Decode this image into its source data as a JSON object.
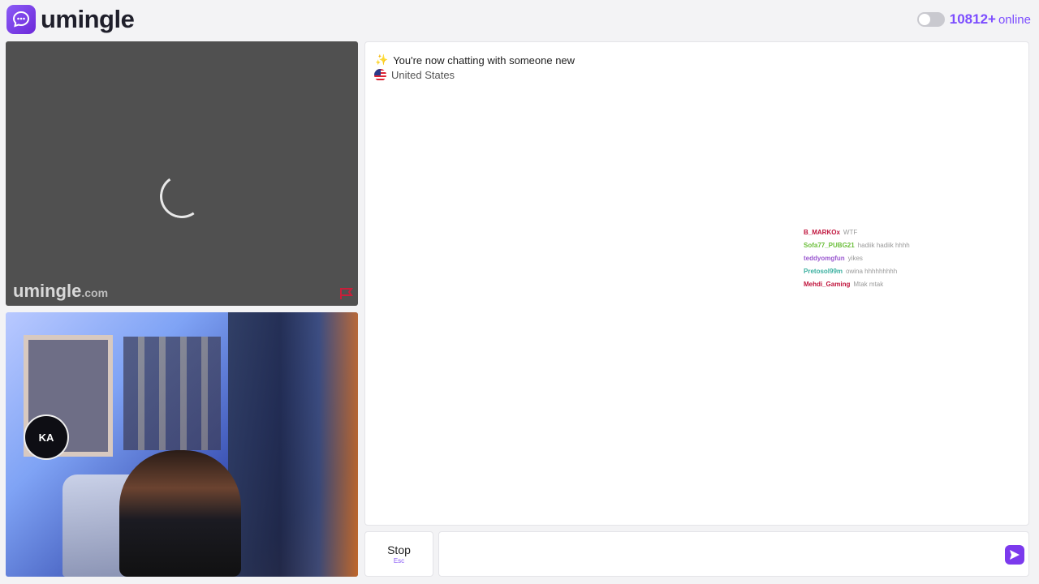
{
  "header": {
    "brand": "umingle",
    "online_count": "10812+",
    "online_label": "online"
  },
  "remote_video": {
    "watermark_brand": "umingle",
    "watermark_tld": ".com"
  },
  "local_video": {
    "badge_text": "KA"
  },
  "chat": {
    "notice": "You're now chatting with someone new",
    "country": "United States",
    "overlay_messages": [
      {
        "user": "B_MARKOx",
        "msg": "WTF",
        "color": "#c0143c"
      },
      {
        "user": "Sofa77_PUBG21",
        "msg": "hadiik hadiik hhhh",
        "color": "#6bbf3a"
      },
      {
        "user": "teddyomgfun",
        "msg": "yikes",
        "color": "#9b59d0"
      },
      {
        "user": "Pretosol99m",
        "msg": "owina hhhhhhhhh",
        "color": "#3bb0a0"
      },
      {
        "user": "Mehdi_Gaming",
        "msg": "Mtak mtak",
        "color": "#c0143c"
      }
    ]
  },
  "controls": {
    "stop_label": "Stop",
    "stop_key": "Esc",
    "message_placeholder": ""
  },
  "colors": {
    "accent": "#7c4dff",
    "send": "#7c3aed"
  }
}
